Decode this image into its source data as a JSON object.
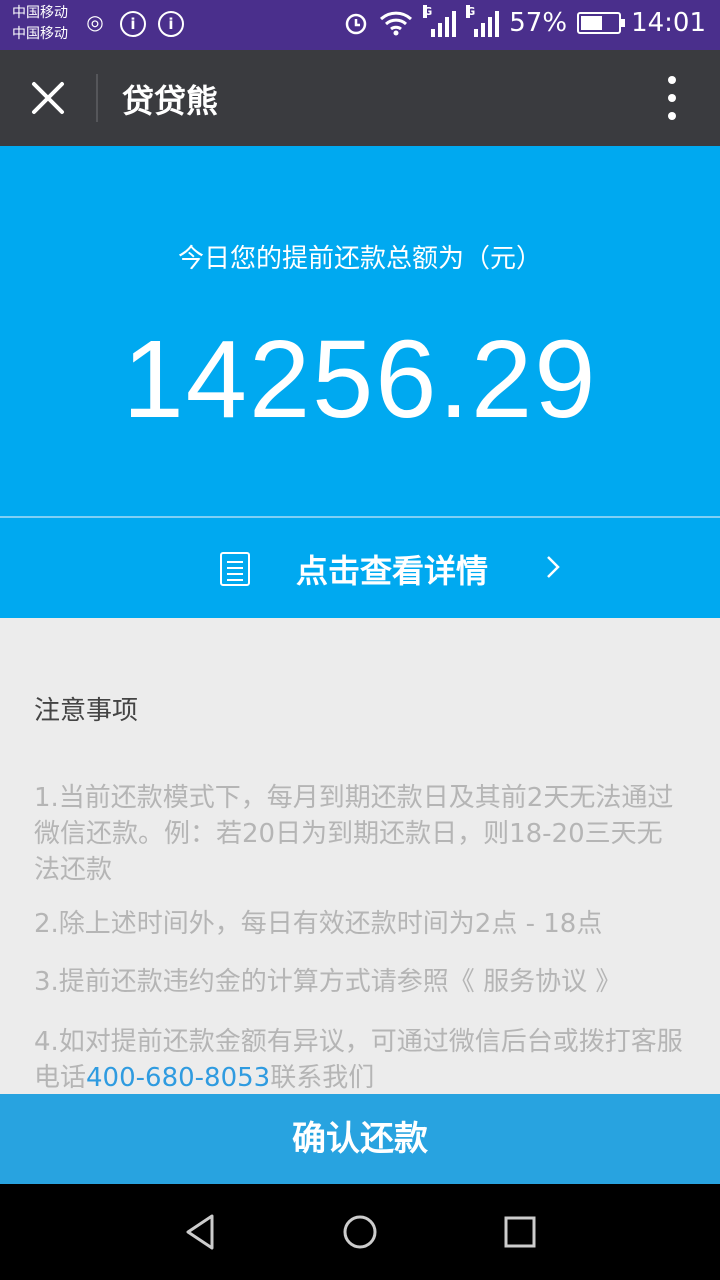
{
  "status_bar": {
    "carrier_1": "中国移动",
    "carrier_2": "中国移动",
    "battery": "57%",
    "battery_level": 0.57,
    "time": "14:01"
  },
  "title_bar": {
    "title": "贷贷熊"
  },
  "hero": {
    "label": "今日您的提前还款总额为（元）",
    "amount": "14256.29"
  },
  "detail": {
    "label": "点击查看详情"
  },
  "notes": {
    "title": "注意事项",
    "items": [
      "1.当前还款模式下，每月到期还款日及其前2天无法通过微信还款。例：若20日为到期还款日，则18-20三天无法还款",
      "2.除上述时间外，每日有效还款时间为2点 - 18点",
      "3.提前还款违约金的计算方式请参照《 服务协议 》"
    ],
    "item4_prefix": "4.如对提前还款金额有异议，可通过微信后台或拨打客服电话",
    "phone": "400-680-8053",
    "item4_suffix": "联系我们"
  },
  "confirm_label": "确认还款",
  "colors": {
    "status_bar": "#4a2f8c",
    "title_bar": "#3a3b3f",
    "accent": "#00a9f0",
    "confirm": "#28a3e0"
  }
}
